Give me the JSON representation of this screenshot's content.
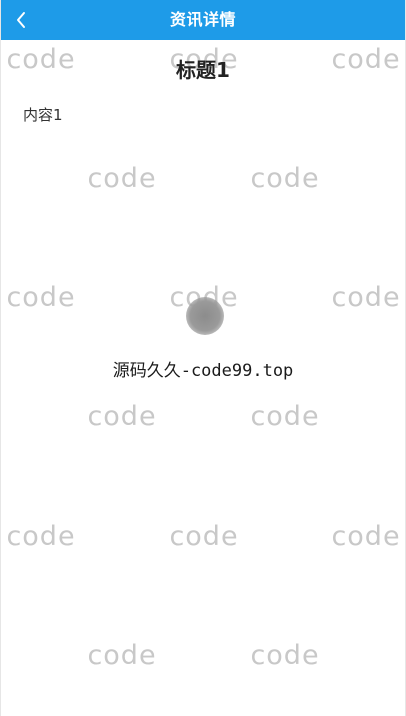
{
  "header": {
    "title": "资讯详情",
    "back_icon": "chevron-left-icon",
    "background_color": "#1e9be8"
  },
  "article": {
    "title": "标题1",
    "content": "内容1"
  },
  "loading": {
    "text": "源码久久-code99.top"
  },
  "watermark": {
    "text": "code"
  }
}
